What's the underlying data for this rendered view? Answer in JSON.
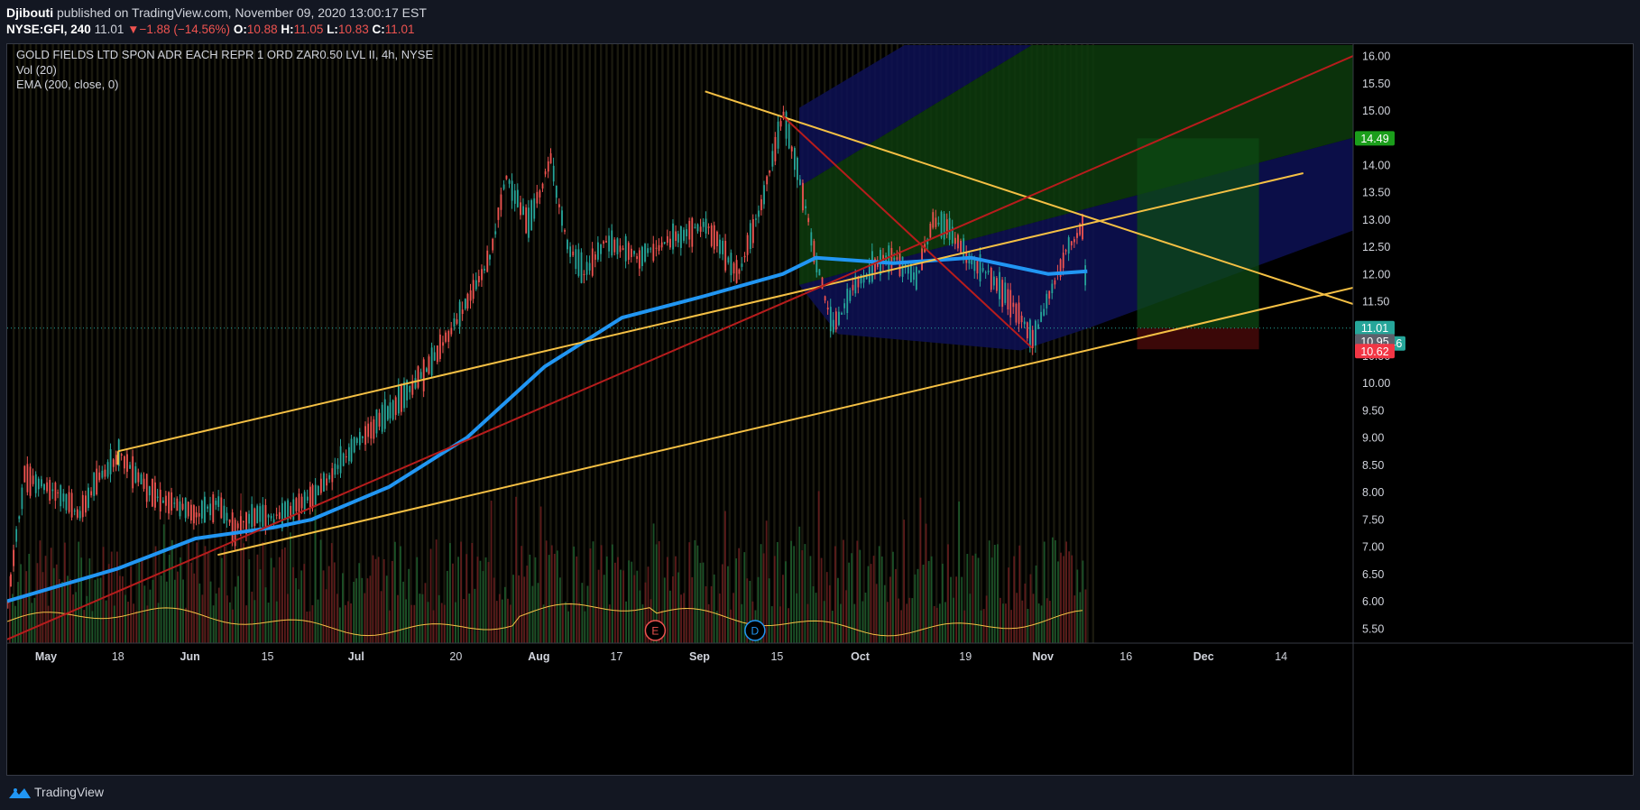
{
  "header": {
    "author": "Djibouti",
    "published": "published on TradingView.com, November 09, 2020 13:00:17 EST",
    "symbol": "NYSE:GFI, 240",
    "last": "11.01",
    "change_arrow": "▼",
    "change": "−1.88 (−14.56%)",
    "o_label": "O:",
    "o_value": "10.88",
    "h_label": "H:",
    "h_value": "11.05",
    "l_label": "L:",
    "l_value": "10.83",
    "c_label": "C:",
    "c_value": "11.01"
  },
  "legend": {
    "title": "GOLD FIELDS LTD SPON ADR EACH REPR 1 ORD ZAR0.50 LVL II, 4h, NYSE",
    "vol": "Vol (20)",
    "ema": "EMA (200, close, 0)"
  },
  "footer": {
    "brand": "TradingView"
  },
  "colors": {
    "bg": "#000000",
    "up": "#26a69a",
    "down": "#ef5350",
    "ema": "#2196f3",
    "trendline": "#f5c044",
    "redline": "#b71c1c",
    "vol_ma": "#f5c044"
  },
  "chart_data": {
    "type": "candlestick",
    "title": "GOLD FIELDS LTD SPON ADR EACH REPR 1 ORD ZAR0.50 LVL II, 4h, NYSE",
    "ylim": [
      5.2,
      16.2
    ],
    "yticks": [
      "16.00",
      "15.50",
      "15.00",
      "14.50",
      "14.00",
      "13.50",
      "13.00",
      "12.50",
      "12.00",
      "11.50",
      "11.00",
      "10.50",
      "10.00",
      "9.50",
      "9.00",
      "8.50",
      "8.00",
      "7.50",
      "7.00",
      "6.50",
      "6.00",
      "5.50"
    ],
    "xticks": [
      "May",
      "18",
      "Jun",
      "15",
      "Jul",
      "20",
      "Aug",
      "17",
      "Sep",
      "15",
      "Oct",
      "19",
      "Nov",
      "16",
      "Dec",
      "14"
    ],
    "price_path": [
      {
        "date": "2020-04-28",
        "close": 6.0
      },
      {
        "date": "2020-05-01",
        "close": 8.3
      },
      {
        "date": "2020-05-07",
        "close": 8.0
      },
      {
        "date": "2020-05-11",
        "close": 7.6
      },
      {
        "date": "2020-05-14",
        "close": 8.2
      },
      {
        "date": "2020-05-18",
        "close": 8.7
      },
      {
        "date": "2020-05-25",
        "close": 7.9
      },
      {
        "date": "2020-06-01",
        "close": 7.6
      },
      {
        "date": "2020-06-05",
        "close": 7.8
      },
      {
        "date": "2020-06-08",
        "close": 7.3
      },
      {
        "date": "2020-06-12",
        "close": 7.6
      },
      {
        "date": "2020-06-15",
        "close": 7.5
      },
      {
        "date": "2020-06-22",
        "close": 7.9
      },
      {
        "date": "2020-06-29",
        "close": 8.8
      },
      {
        "date": "2020-07-06",
        "close": 9.5
      },
      {
        "date": "2020-07-13",
        "close": 10.3
      },
      {
        "date": "2020-07-20",
        "close": 11.5
      },
      {
        "date": "2020-07-24",
        "close": 12.3
      },
      {
        "date": "2020-07-27",
        "close": 13.8
      },
      {
        "date": "2020-07-31",
        "close": 12.9
      },
      {
        "date": "2020-08-04",
        "close": 14.1
      },
      {
        "date": "2020-08-07",
        "close": 12.5
      },
      {
        "date": "2020-08-10",
        "close": 12.0
      },
      {
        "date": "2020-08-14",
        "close": 12.6
      },
      {
        "date": "2020-08-20",
        "close": 12.3
      },
      {
        "date": "2020-08-27",
        "close": 12.7
      },
      {
        "date": "2020-09-01",
        "close": 12.9
      },
      {
        "date": "2020-09-07",
        "close": 12.0
      },
      {
        "date": "2020-09-11",
        "close": 13.3
      },
      {
        "date": "2020-09-15",
        "close": 14.9
      },
      {
        "date": "2020-09-18",
        "close": 13.7
      },
      {
        "date": "2020-09-21",
        "close": 12.2
      },
      {
        "date": "2020-09-24",
        "close": 11.0
      },
      {
        "date": "2020-09-28",
        "close": 11.8
      },
      {
        "date": "2020-10-02",
        "close": 12.2
      },
      {
        "date": "2020-10-05",
        "close": 12.3
      },
      {
        "date": "2020-10-09",
        "close": 11.9
      },
      {
        "date": "2020-10-12",
        "close": 13.0
      },
      {
        "date": "2020-10-15",
        "close": 12.8
      },
      {
        "date": "2020-10-19",
        "close": 12.2
      },
      {
        "date": "2020-10-22",
        "close": 12.0
      },
      {
        "date": "2020-10-26",
        "close": 11.5
      },
      {
        "date": "2020-10-30",
        "close": 10.8
      },
      {
        "date": "2020-11-02",
        "close": 11.6
      },
      {
        "date": "2020-11-05",
        "close": 12.4
      },
      {
        "date": "2020-11-08",
        "close": 12.9
      },
      {
        "date": "2020-11-09",
        "close": 11.01
      }
    ],
    "ema200": [
      {
        "date": "2020-04-28",
        "value": 6.0
      },
      {
        "date": "2020-05-18",
        "value": 6.6
      },
      {
        "date": "2020-06-01",
        "value": 7.15
      },
      {
        "date": "2020-06-15",
        "value": 7.35
      },
      {
        "date": "2020-06-22",
        "value": 7.5
      },
      {
        "date": "2020-07-06",
        "value": 8.1
      },
      {
        "date": "2020-07-20",
        "value": 9.0
      },
      {
        "date": "2020-08-03",
        "value": 10.3
      },
      {
        "date": "2020-08-17",
        "value": 11.2
      },
      {
        "date": "2020-09-01",
        "value": 11.6
      },
      {
        "date": "2020-09-15",
        "value": 12.0
      },
      {
        "date": "2020-09-21",
        "value": 12.3
      },
      {
        "date": "2020-10-05",
        "value": 12.2
      },
      {
        "date": "2020-10-19",
        "value": 12.3
      },
      {
        "date": "2020-11-02",
        "value": 12.0
      },
      {
        "date": "2020-11-09",
        "value": 12.05
      }
    ],
    "trendlines": [
      {
        "color": "yellow",
        "from": {
          "date": "2020-05-18",
          "price": 8.75
        },
        "to": {
          "date": "2020-12-18",
          "price": 13.85
        }
      },
      {
        "color": "yellow",
        "from": {
          "date": "2020-06-05",
          "price": 6.85
        },
        "to": {
          "date": "2020-12-27",
          "price": 11.75
        }
      },
      {
        "color": "yellow",
        "from": {
          "date": "2020-09-01",
          "price": 15.35
        },
        "to": {
          "date": "2020-12-27",
          "price": 11.45
        }
      },
      {
        "color": "red",
        "from": {
          "date": "2020-04-28",
          "price": 5.3
        },
        "to": {
          "date": "2020-12-27",
          "price": 16.0
        }
      },
      {
        "color": "red",
        "from": {
          "date": "2020-09-15",
          "price": 14.9
        },
        "to": {
          "date": "2020-10-30",
          "price": 10.65
        }
      }
    ],
    "position": {
      "entry": 11.01,
      "target": 14.49,
      "stop": 10.62,
      "start": "2020-11-18",
      "end": "2020-12-10"
    },
    "price_labels": [
      {
        "text": "14.49",
        "color": "#1b9e1b"
      },
      {
        "text": "11.01",
        "color": "#26a69a"
      },
      {
        "text": "02:59:46",
        "color": "#26a69a"
      },
      {
        "text": "10.95",
        "color": "#5d606b"
      },
      {
        "text": "10.62",
        "color": "#f23645"
      }
    ],
    "event_markers": [
      {
        "label": "E",
        "date": "2020-08-23",
        "color": "#ef5350"
      },
      {
        "label": "D",
        "date": "2020-09-10",
        "color": "#2196f3"
      }
    ],
    "grid": true,
    "scale": "linear"
  }
}
